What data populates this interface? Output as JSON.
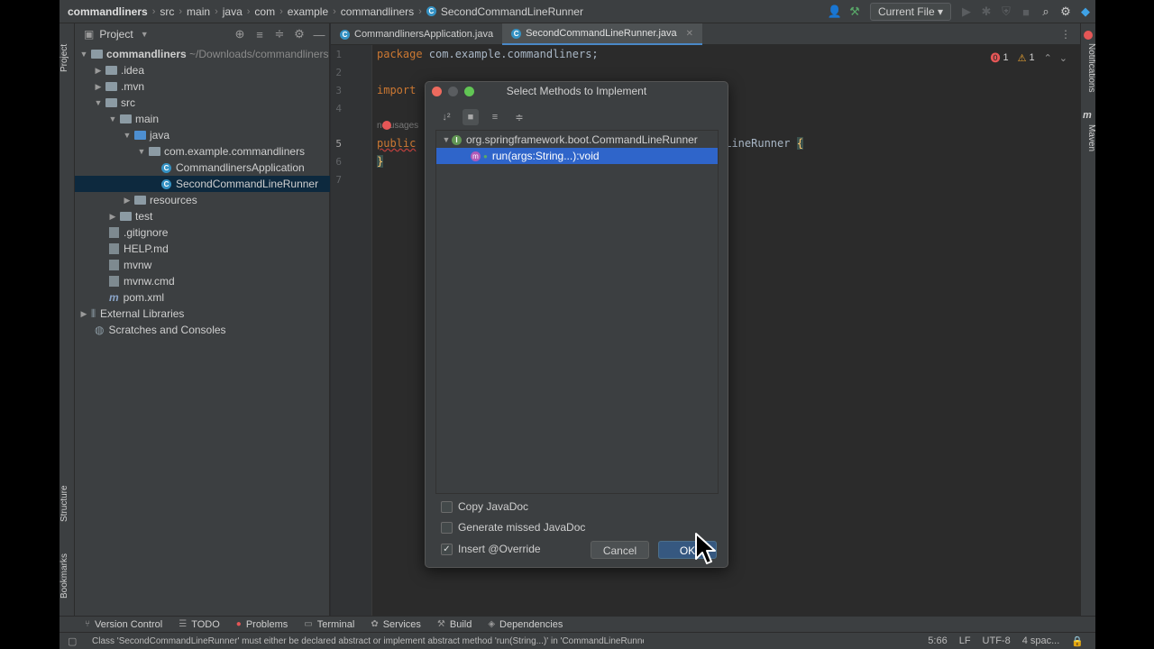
{
  "navbar": {
    "breadcrumbs": [
      "commandliners",
      "src",
      "main",
      "java",
      "com",
      "example",
      "commandliners",
      "SecondCommandLineRunner"
    ],
    "run_config": "Current File"
  },
  "left_strip": {
    "project": "Project",
    "structure": "Structure",
    "bookmarks": "Bookmarks"
  },
  "right_strip": {
    "notifications": "Notifications",
    "maven": "Maven"
  },
  "project_panel": {
    "title": "Project",
    "tree": [
      {
        "label": "commandliners",
        "hint": "~/Downloads/commandliners"
      },
      {
        "label": ".idea"
      },
      {
        "label": ".mvn"
      },
      {
        "label": "src"
      },
      {
        "label": "main"
      },
      {
        "label": "java"
      },
      {
        "label": "com.example.commandliners"
      },
      {
        "label": "CommandlinersApplication"
      },
      {
        "label": "SecondCommandLineRunner"
      },
      {
        "label": "resources"
      },
      {
        "label": "test"
      },
      {
        "label": ".gitignore"
      },
      {
        "label": "HELP.md"
      },
      {
        "label": "mvnw"
      },
      {
        "label": "mvnw.cmd"
      },
      {
        "label": "pom.xml"
      },
      {
        "label": "External Libraries"
      },
      {
        "label": "Scratches and Consoles"
      }
    ]
  },
  "tabs": [
    {
      "label": "CommandlinersApplication.java"
    },
    {
      "label": "SecondCommandLineRunner.java"
    }
  ],
  "editor": {
    "line_numbers": [
      "1",
      "2",
      "3",
      "4",
      "5",
      "6",
      "7"
    ],
    "line1_kw": "package",
    "line1_rest": " com.example.commandliners;",
    "line3_kw": "import",
    "inlay": "no usages",
    "line5_kw": "public",
    "line5_tail": "dLineRunner ",
    "line5_brace": "{",
    "line6": "}",
    "errors": "1",
    "warnings": "1"
  },
  "dialog": {
    "title": "Select Methods to Implement",
    "interface": "org.springframework.boot.CommandLineRunner",
    "method": "run(args:String...):void",
    "copy_javadoc": "Copy JavaDoc",
    "generate_javadoc": "Generate missed JavaDoc",
    "insert_override": "Insert @Override",
    "cancel": "Cancel",
    "ok": "OK"
  },
  "bottom_tools": [
    "Version Control",
    "TODO",
    "Problems",
    "Terminal",
    "Services",
    "Build",
    "Dependencies"
  ],
  "status": {
    "message": "Class 'SecondCommandLineRunner' must either be declared abstract or implement abstract method 'run(String...)' in 'CommandLineRunner'",
    "position": "5:66",
    "line_sep": "LF",
    "encoding": "UTF-8",
    "indent": "4 spac..."
  },
  "colors": {
    "accent": "#2f65ca",
    "error": "#e55656",
    "warning": "#f0a732"
  }
}
